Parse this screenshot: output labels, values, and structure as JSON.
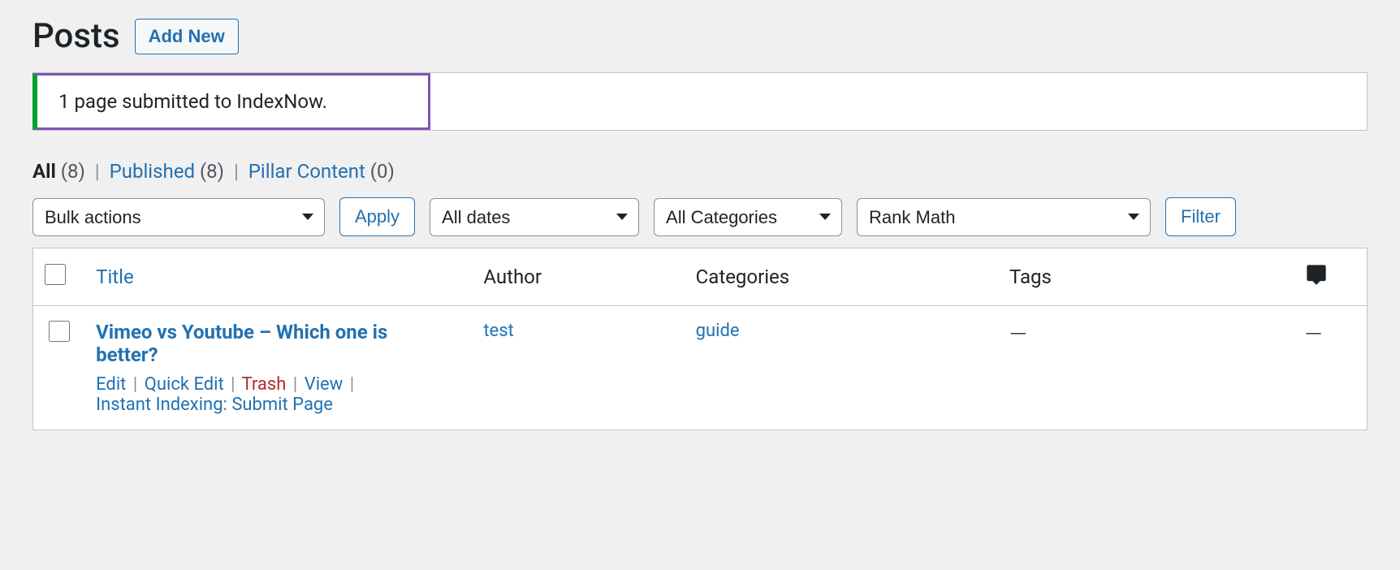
{
  "header": {
    "title": "Posts",
    "add_new": "Add New"
  },
  "notice": {
    "message": "1 page submitted to IndexNow."
  },
  "filters": {
    "all_label": "All",
    "all_count": "(8)",
    "published_label": "Published",
    "published_count": "(8)",
    "pillar_label": "Pillar Content",
    "pillar_count": "(0)"
  },
  "tablenav": {
    "bulk_actions": "Bulk actions",
    "apply": "Apply",
    "all_dates": "All dates",
    "all_categories": "All Categories",
    "rank_math": "Rank Math",
    "filter": "Filter"
  },
  "columns": {
    "title": "Title",
    "author": "Author",
    "categories": "Categories",
    "tags": "Tags"
  },
  "row": {
    "title": "Vimeo vs Youtube – Which one is better?",
    "author": "test",
    "category": "guide",
    "tags": "—",
    "comments": "—",
    "actions": {
      "edit": "Edit",
      "quick_edit": "Quick Edit",
      "trash": "Trash",
      "view": "View",
      "instant_indexing": "Instant Indexing: Submit Page"
    }
  }
}
